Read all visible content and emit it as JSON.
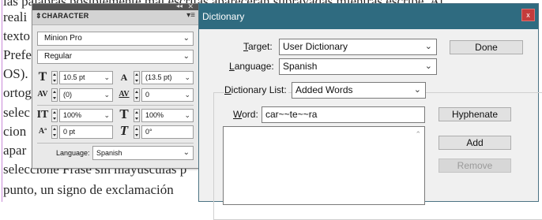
{
  "document": {
    "lines": [
      "las palabras posiblemente mal escritas aparecerán subrayadas mientras escribe. Al",
      "reali",
      "texto",
      "Prefe",
      "OS).",
      "ortog",
      "selec",
      "cion",
      "apar",
      "seleccione Frase sin mayúsculas p",
      "punto, un signo de exclamación"
    ]
  },
  "character_panel": {
    "collapse_glyph": "◂◂",
    "close_glyph": "✕",
    "title": "CHARACTER",
    "menu_glyph": "▾≡",
    "font_family": "Minion Pro",
    "font_style": "Regular",
    "font_size": "10.5 pt",
    "leading": "(13.5 pt)",
    "kerning": "(0)",
    "tracking": "0",
    "vertical_scale": "100%",
    "horizontal_scale": "100%",
    "baseline_shift": "0 pt",
    "skew": "0°",
    "language_label": "Language:",
    "language_value": "Spanish",
    "icons": {
      "font_size": "T",
      "leading": "A",
      "kerning": "AV",
      "tracking": "AV",
      "vertical_scale": "IT",
      "horizontal_scale": "T",
      "baseline_shift": "Aª",
      "skew": "T"
    }
  },
  "dictionary_dialog": {
    "title": "Dictionary",
    "close_glyph": "x",
    "target_label": "Target:",
    "target_accel": "T",
    "target_rest": "arget:",
    "target_value": "User Dictionary",
    "language_accel": "L",
    "language_rest": "anguage:",
    "language_value": "Spanish",
    "dictionary_list_accel": "D",
    "dictionary_list_rest": "ictionary List:",
    "dictionary_list_value": "Added Words",
    "word_accel": "W",
    "word_rest": "ord:",
    "word_value": "car~~te~~ra",
    "buttons": {
      "done": "Done",
      "hyphenate": "Hyphenate",
      "add": "Add",
      "remove": "Remove"
    },
    "accent": "#2f6b80"
  }
}
